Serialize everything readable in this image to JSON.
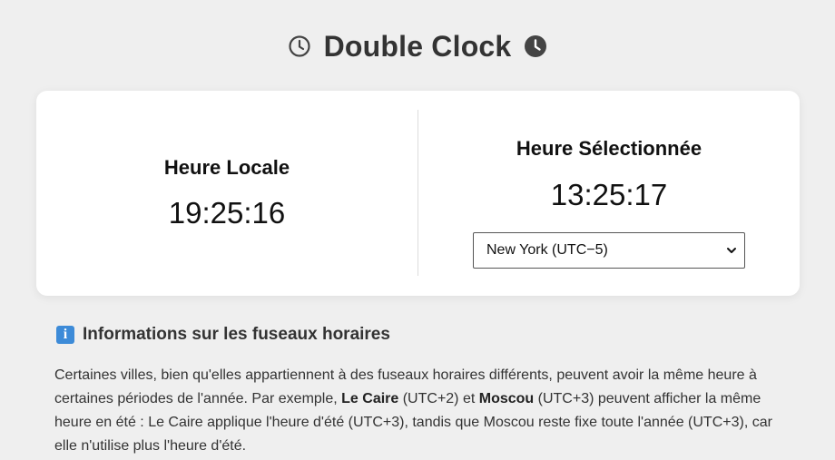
{
  "app": {
    "title": "Double Clock"
  },
  "icons": {
    "title_left": "clock-outline-icon",
    "title_right": "clock-filled-icon",
    "info": "info-icon",
    "select_arrow": "chevron-down-icon"
  },
  "local": {
    "label": "Heure Locale",
    "time": "19:25:16"
  },
  "selected": {
    "label": "Heure Sélectionnée",
    "time": "13:25:17",
    "timezone_value": "New York (UTC−5)"
  },
  "info": {
    "badge": "i",
    "title": "Informations sur les fuseaux horaires",
    "text_1": "Certaines villes, bien qu'elles appartiennent à des fuseaux horaires différents, peuvent avoir la même heure à certaines périodes de l'année. Par exemple, ",
    "city_1": "Le Caire",
    "text_2": " (UTC+2) et ",
    "city_2": "Moscou",
    "text_3": " (UTC+3) peuvent afficher la même heure en été : Le Caire applique l'heure d'été (UTC+3), tandis que Moscou reste fixe toute l'année (UTC+3), car elle n'utilise plus l'heure d'été."
  },
  "colors": {
    "background": "#efefef",
    "card": "#ffffff",
    "text": "#333333",
    "info_badge": "#3d8bd8"
  }
}
